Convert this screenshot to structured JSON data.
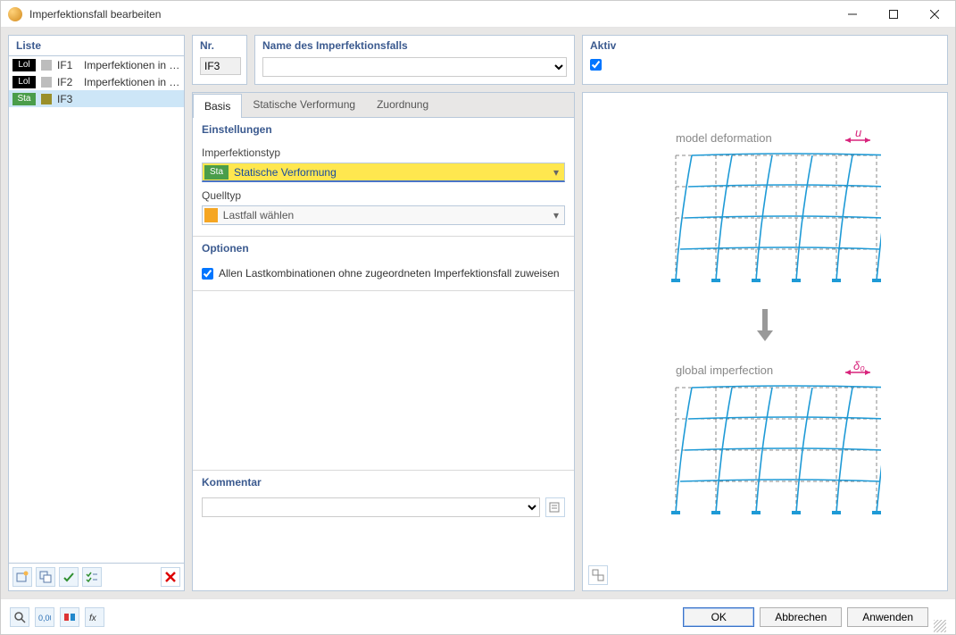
{
  "window": {
    "title": "Imperfektionsfall bearbeiten"
  },
  "sidebar": {
    "header": "Liste",
    "items": [
      {
        "tag_class": "black",
        "tag_text": "Lol",
        "swatch": "gray",
        "num": "IF1",
        "text": "Imperfektionen in +Y",
        "selected": false
      },
      {
        "tag_class": "black",
        "tag_text": "Lol",
        "swatch": "gray",
        "num": "IF2",
        "text": "Imperfektionen in +X",
        "selected": false
      },
      {
        "tag_class": "green",
        "tag_text": "Sta",
        "swatch": "olive",
        "num": "IF3",
        "text": "",
        "selected": true
      }
    ]
  },
  "nr": {
    "label": "Nr.",
    "value": "IF3"
  },
  "name": {
    "label": "Name des Imperfektionsfalls",
    "value": ""
  },
  "aktiv": {
    "label": "Aktiv",
    "checked": true
  },
  "tabs": [
    {
      "label": "Basis",
      "active": true
    },
    {
      "label": "Statische Verformung",
      "active": false
    },
    {
      "label": "Zuordnung",
      "active": false
    }
  ],
  "einstellungen": {
    "title": "Einstellungen",
    "imperfektionstyp_label": "Imperfektionstyp",
    "imperfektionstyp_tag": "Sta",
    "imperfektionstyp_value": "Statische Verformung",
    "quelltyp_label": "Quelltyp",
    "quelltyp_value": "Lastfall wählen"
  },
  "optionen": {
    "title": "Optionen",
    "assign_all_label": "Allen Lastkombinationen ohne zugeordneten Imperfektionsfall zuweisen",
    "assign_all_checked": true
  },
  "kommentar": {
    "title": "Kommentar",
    "value": ""
  },
  "diagram": {
    "top_label": "model deformation",
    "top_annot": "u",
    "bottom_label": "global imperfection",
    "bottom_annot": "δ₀"
  },
  "buttons": {
    "ok": "OK",
    "cancel": "Abbrechen",
    "apply": "Anwenden"
  }
}
